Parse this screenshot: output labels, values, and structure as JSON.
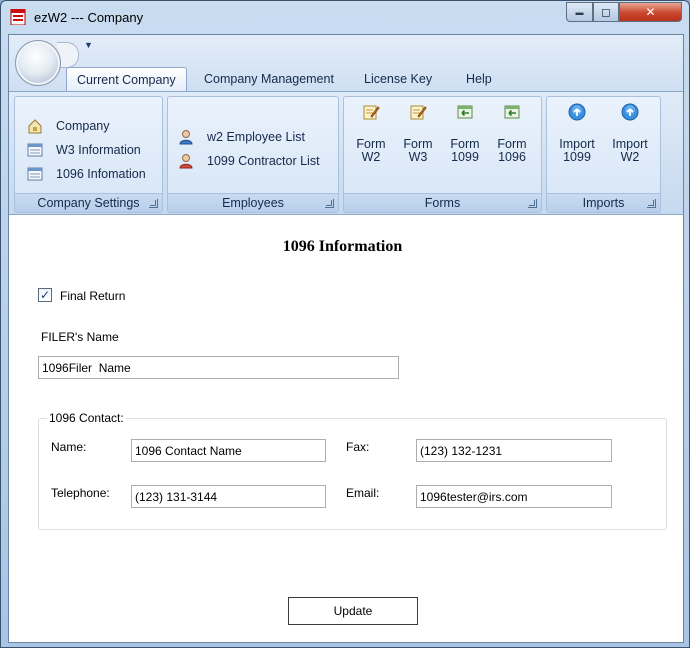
{
  "window": {
    "title": "ezW2 --- Company",
    "controls": {
      "minimize": "▬",
      "maximize": "◻",
      "close": "✕"
    }
  },
  "ribbon": {
    "tabs": [
      {
        "label": "Current Company",
        "active": true
      },
      {
        "label": "Company Management"
      },
      {
        "label": "License Key"
      },
      {
        "label": "Help"
      }
    ],
    "groups": {
      "company_settings": {
        "label": "Company Settings",
        "items": [
          {
            "label": "Company",
            "icon": "lock-house-icon"
          },
          {
            "label": "W3 Information",
            "icon": "form-icon"
          },
          {
            "label": "1096 Infomation",
            "icon": "form-icon"
          }
        ]
      },
      "employees": {
        "label": "Employees",
        "items": [
          {
            "label": "w2 Employee List",
            "icon": "blue-person-icon"
          },
          {
            "label": "1099 Contractor List",
            "icon": "red-person-icon"
          }
        ]
      },
      "forms": {
        "label": "Forms",
        "items": [
          {
            "line1": "Form",
            "line2": "W2",
            "icon": "edit-form-icon"
          },
          {
            "line1": "Form",
            "line2": "W3",
            "icon": "edit-form-icon"
          },
          {
            "line1": "Form",
            "line2": "1099",
            "icon": "export-arrow-icon"
          },
          {
            "line1": "Form",
            "line2": "1096",
            "icon": "export-arrow-icon"
          }
        ]
      },
      "imports": {
        "label": "Imports",
        "items": [
          {
            "line1": "Import",
            "line2": "1099",
            "icon": "upload-circle-icon"
          },
          {
            "line1": "Import",
            "line2": "W2",
            "icon": "upload-circle-icon"
          }
        ]
      }
    }
  },
  "form": {
    "heading": "1096 Information",
    "final_return": {
      "label": "Final Return",
      "checked": true
    },
    "filer_name_label": "FILER's Name",
    "filer_name_value": "1096Filer  Name",
    "contact": {
      "legend": "1096 Contact:",
      "name_label": "Name:",
      "name_value": "1096 Contact Name",
      "fax_label": "Fax:",
      "fax_value": "(123) 132-1231",
      "telephone_label": "Telephone:",
      "telephone_value": "(123) 131-3144",
      "email_label": "Email:",
      "email_value": "1096tester@irs.com"
    },
    "update_label": "Update"
  }
}
